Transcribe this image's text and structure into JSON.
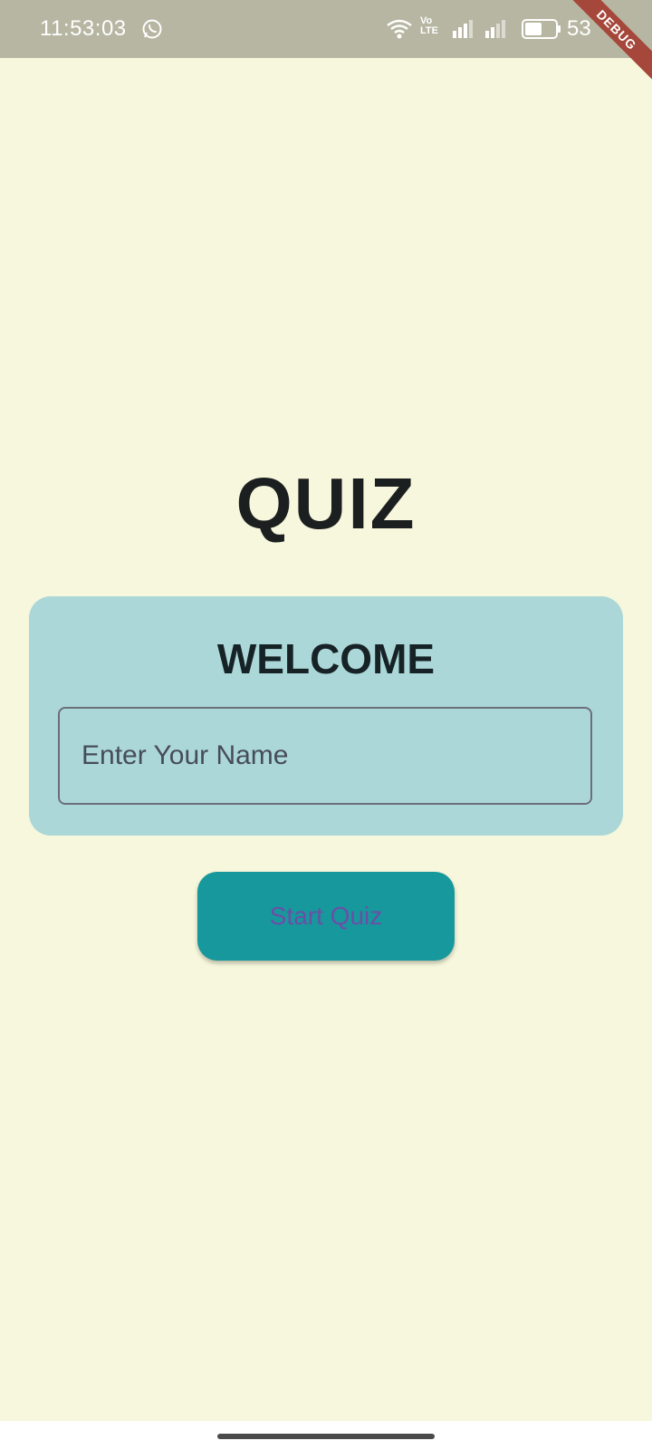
{
  "status_bar": {
    "time": "11:53:03",
    "battery": "53",
    "volte_line1": "Vo",
    "volte_line2": "LTE",
    "debug_label": "DEBUG"
  },
  "main": {
    "title": "QUIZ",
    "welcome_heading": "WELCOME",
    "name_placeholder": "Enter Your Name",
    "start_button_label": "Start Quiz"
  },
  "colors": {
    "background": "#f6f7dc",
    "card": "#abd7d8",
    "button": "#17989c",
    "button_text": "#6b4fa6"
  }
}
